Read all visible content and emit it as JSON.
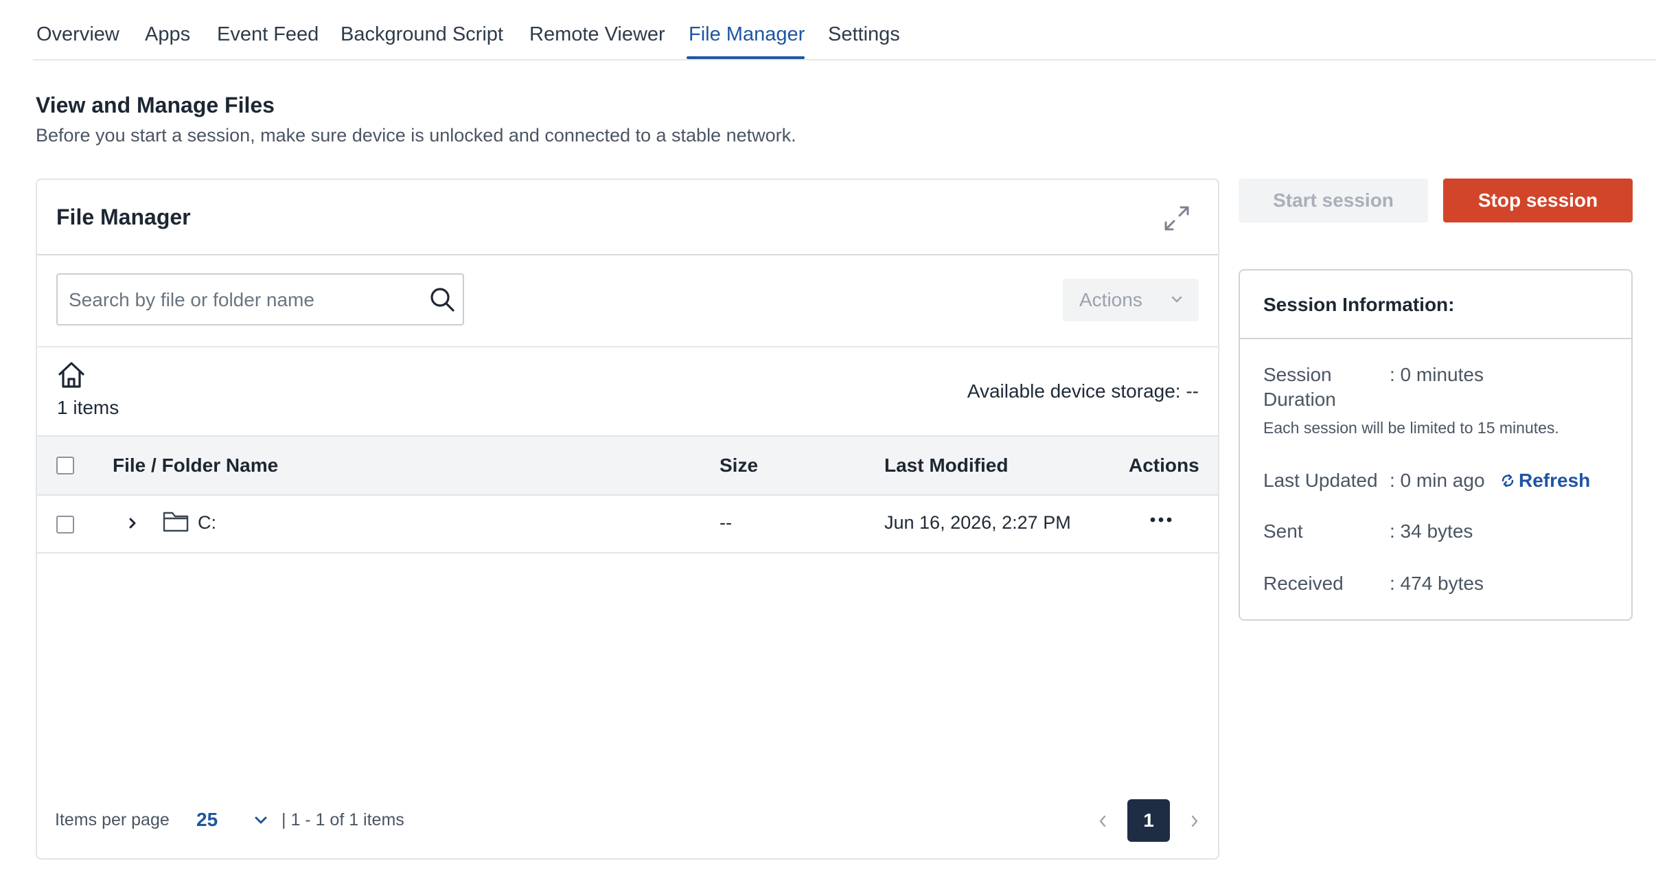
{
  "tabs": [
    {
      "label": "Overview"
    },
    {
      "label": "Apps"
    },
    {
      "label": "Event Feed"
    },
    {
      "label": "Background Script"
    },
    {
      "label": "Remote Viewer"
    },
    {
      "label": "File Manager",
      "active": true
    },
    {
      "label": "Settings"
    }
  ],
  "page": {
    "title": "View and Manage Files",
    "subtitle": "Before you start a session, make sure device is unlocked and connected to a stable network."
  },
  "file_manager": {
    "title": "File Manager",
    "search_placeholder": "Search by file or folder name",
    "actions_label": "Actions",
    "items_count": "1 items",
    "storage": "Available device storage: --",
    "columns": {
      "name": "File / Folder Name",
      "size": "Size",
      "modified": "Last Modified",
      "actions": "Actions"
    },
    "rows": [
      {
        "name": "C:",
        "size": "--",
        "modified": "Jun 16, 2026, 2:27 PM",
        "type": "folder"
      }
    ],
    "pagination": {
      "items_per_page_label": "Items per page",
      "items_per_page": "25",
      "range": "| 1 - 1 of 1 items",
      "current_page": "1"
    }
  },
  "session": {
    "start_label": "Start session",
    "stop_label": "Stop session",
    "info_title": "Session Information:",
    "duration_label_1": "Session",
    "duration_label_2": "Duration",
    "duration_value": ": 0 minutes",
    "limit_note": "Each session will be limited to 15 minutes.",
    "updated_label": "Last Updated",
    "updated_value": ": 0 min ago",
    "refresh_label": "Refresh",
    "sent_label": "Sent",
    "sent_value": ": 34 bytes",
    "received_label": "Received",
    "received_value": ": 474 bytes"
  },
  "colors": {
    "accent": "#1f55a3",
    "danger": "#d2452a",
    "page_badge": "#1f2d44"
  }
}
